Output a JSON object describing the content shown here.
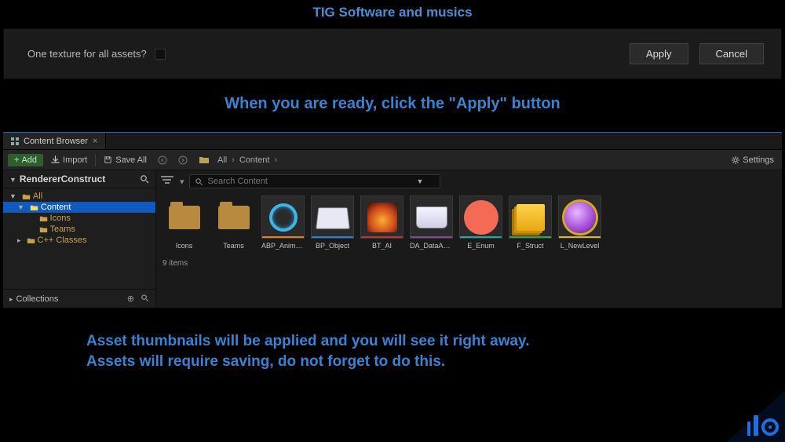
{
  "header": {
    "title": "TIG Software and musics"
  },
  "dialog": {
    "label": "One texture for all assets?",
    "checked": false,
    "apply": "Apply",
    "cancel": "Cancel"
  },
  "captions": {
    "line1": "When you are ready, click the \"Apply\" button",
    "line2a": "Asset thumbnails will be applied and you will see it right away.",
    "line2b": "Assets will require saving, do not forget to do this."
  },
  "browser": {
    "tab": {
      "title": "Content Browser",
      "close": "×"
    },
    "toolbar": {
      "add": "Add",
      "import": "Import",
      "saveall": "Save All",
      "crumb_root": "All",
      "crumb_next": "Content",
      "settings": "Settings"
    },
    "side": {
      "project": "RendererConstruct",
      "collections": "Collections",
      "tree": [
        {
          "label": "All",
          "depth": 0,
          "expanded": true,
          "selected": false,
          "color": "#c7a24a"
        },
        {
          "label": "Content",
          "depth": 1,
          "expanded": true,
          "selected": true,
          "color": "#ffffff"
        },
        {
          "label": "Icons",
          "depth": 2,
          "expanded": false,
          "selected": false,
          "color": "#c7a24a"
        },
        {
          "label": "Teams",
          "depth": 2,
          "expanded": false,
          "selected": false,
          "color": "#c7a24a"
        },
        {
          "label": "C++ Classes",
          "depth": 1,
          "expanded": false,
          "selected": false,
          "color": "#c7a24a"
        }
      ]
    },
    "search": {
      "placeholder": "Search Content"
    },
    "items": [
      {
        "name": "Icons",
        "kind": "folder",
        "underline": ""
      },
      {
        "name": "Teams",
        "kind": "folder",
        "underline": ""
      },
      {
        "name": "ABP_AnimBP",
        "kind": "asset",
        "art": "ring",
        "underline": "u-orange"
      },
      {
        "name": "BP_Object",
        "kind": "asset",
        "art": "book",
        "underline": "u-blue"
      },
      {
        "name": "BT_AI",
        "kind": "asset",
        "art": "fire",
        "underline": "u-red"
      },
      {
        "name": "DA_DataAsset",
        "kind": "asset",
        "art": "open",
        "underline": "u-purple"
      },
      {
        "name": "E_Enum",
        "kind": "asset",
        "art": "coral",
        "underline": "u-teal"
      },
      {
        "name": "F_Struct",
        "kind": "asset",
        "art": "stack",
        "underline": "u-green"
      },
      {
        "name": "L_NewLevel",
        "kind": "asset",
        "art": "gem",
        "underline": "u-yellow"
      }
    ],
    "status": "9 items"
  }
}
